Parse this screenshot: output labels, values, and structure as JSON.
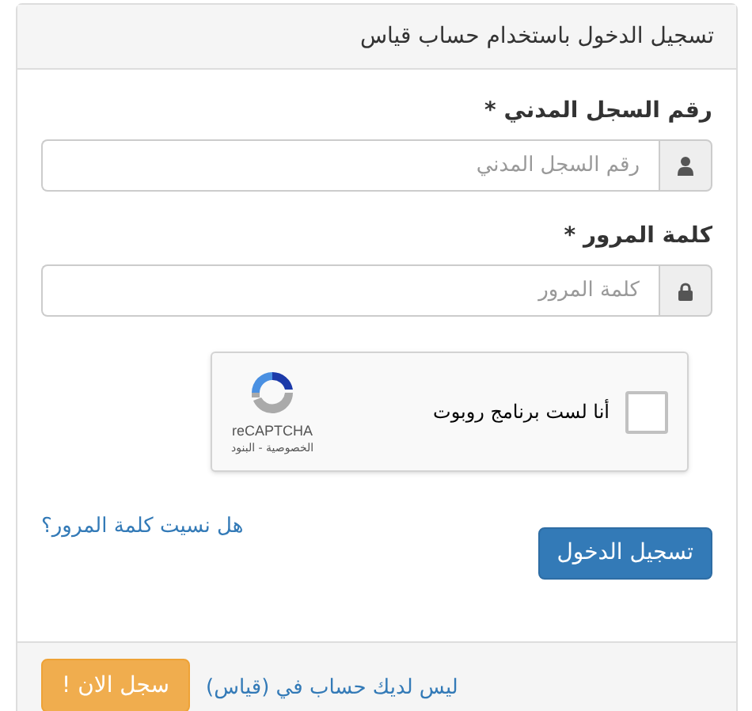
{
  "panel": {
    "title": "تسجيل الدخول باستخدام حساب قياس"
  },
  "fields": [
    {
      "label": "رقم السجل المدني *",
      "placeholder": "رقم السجل المدني",
      "kind": "user"
    },
    {
      "label": "كلمة المرور *",
      "placeholder": "كلمة المرور",
      "kind": "password"
    }
  ],
  "captcha": {
    "label": "أنا لست برنامج روبوت",
    "checked": false,
    "brand": "reCAPTCHA",
    "links": "الخصوصية - البنود"
  },
  "forgot_link": "هل نسيت كلمة المرور؟",
  "login_button": "تسجيل الدخول",
  "footer": {
    "text": "ليس لديك حساب في (قياس)",
    "register_button": "سجل الان !"
  }
}
